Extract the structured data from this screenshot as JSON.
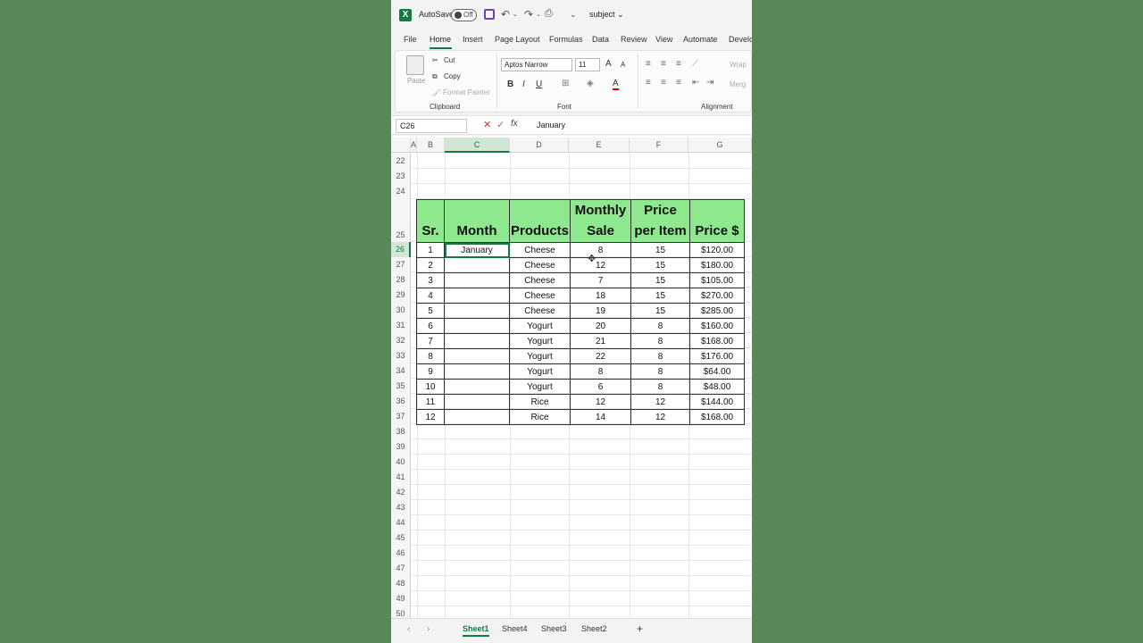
{
  "titlebar": {
    "app_icon": "X",
    "autosave_label": "AutoSave",
    "autosave_state": "Off",
    "document_title": "subject ⌄"
  },
  "tabs": [
    "File",
    "Home",
    "Insert",
    "Page Layout",
    "Formulas",
    "Data",
    "Review",
    "View",
    "Automate",
    "Develo"
  ],
  "ribbon": {
    "clipboard": {
      "paste": "Paste",
      "cut": "Cut",
      "copy": "Copy",
      "format_painter": "Format Painter",
      "group": "Clipboard"
    },
    "font": {
      "name": "Aptos Narrow",
      "size": "11",
      "bold": "B",
      "italic": "I",
      "underline": "U",
      "grow": "A",
      "shrink": "A",
      "group": "Font"
    },
    "alignment": {
      "wrap": "Wrap",
      "merge": "Merg",
      "group": "Alignment"
    }
  },
  "formula_bar": {
    "name_box": "C26",
    "fx": "fx",
    "value": "January"
  },
  "columns": [
    "A",
    "B",
    "C",
    "D",
    "E",
    "F",
    "G"
  ],
  "rows": [
    "22",
    "23",
    "24",
    "25",
    "26",
    "27",
    "28",
    "29",
    "30",
    "31",
    "32",
    "33",
    "34",
    "35",
    "36",
    "37",
    "38",
    "39",
    "40",
    "41",
    "42",
    "43",
    "44",
    "45",
    "46",
    "47",
    "48",
    "49",
    "50"
  ],
  "table": {
    "headers": [
      {
        "line1": "Sr.",
        "line2": ""
      },
      {
        "line1": "Month",
        "line2": ""
      },
      {
        "line1": "Products",
        "line2": ""
      },
      {
        "line1": "Monthly",
        "line2": "Sale"
      },
      {
        "line1": "Price",
        "line2": "per Item"
      },
      {
        "line1": "Price $",
        "line2": ""
      }
    ],
    "rows": [
      [
        "1",
        "January",
        "Cheese",
        "8",
        "15",
        "$120.00"
      ],
      [
        "2",
        "",
        "Cheese",
        "12",
        "15",
        "$180.00"
      ],
      [
        "3",
        "",
        "Cheese",
        "7",
        "15",
        "$105.00"
      ],
      [
        "4",
        "",
        "Cheese",
        "18",
        "15",
        "$270.00"
      ],
      [
        "5",
        "",
        "Cheese",
        "19",
        "15",
        "$285.00"
      ],
      [
        "6",
        "",
        "Yogurt",
        "20",
        "8",
        "$160.00"
      ],
      [
        "7",
        "",
        "Yogurt",
        "21",
        "8",
        "$168.00"
      ],
      [
        "8",
        "",
        "Yogurt",
        "22",
        "8",
        "$176.00"
      ],
      [
        "9",
        "",
        "Yogurt",
        "8",
        "8",
        "$64.00"
      ],
      [
        "10",
        "",
        "Yogurt",
        "6",
        "8",
        "$48.00"
      ],
      [
        "11",
        "",
        "Rice",
        "12",
        "12",
        "$144.00"
      ],
      [
        "12",
        "",
        "Rice",
        "14",
        "12",
        "$168.00"
      ]
    ]
  },
  "sheets": [
    "Sheet1",
    "Sheet4",
    "Sheet3",
    "Sheet2"
  ],
  "add_sheet": "+",
  "colors": {
    "accent": "#107c41",
    "header_fill": "#8ee88e"
  }
}
